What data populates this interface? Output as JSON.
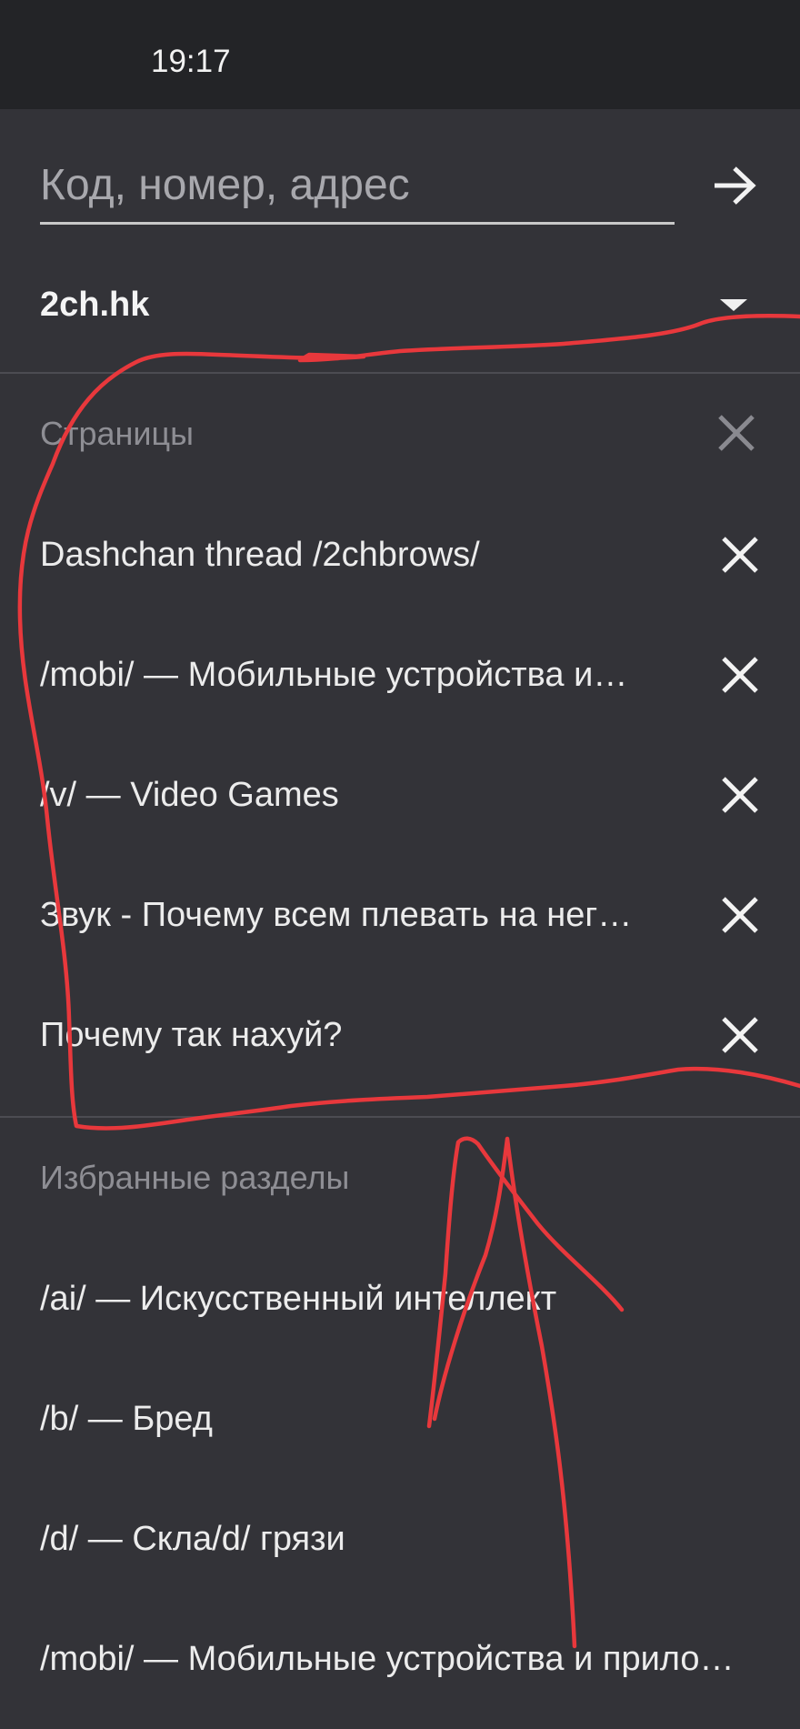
{
  "status_bar": {
    "time": "19:17"
  },
  "search": {
    "placeholder": "Код, номер, адрес",
    "value": ""
  },
  "board_selector": {
    "host": "2ch.hk"
  },
  "pages": {
    "header": "Страницы",
    "items": [
      {
        "label": "Dashchan thread /2chbrows/"
      },
      {
        "label": "/mobi/ — Мобильные устройства и…"
      },
      {
        "label": "/v/ — Video Games"
      },
      {
        "label": "Звук - Почему всем плевать на нег…"
      },
      {
        "label": "Почему так нахуй?"
      }
    ]
  },
  "favorites": {
    "header": "Избранные разделы",
    "items": [
      {
        "label": "/ai/ — Искусственный интеллект"
      },
      {
        "label": "/b/ — Бред"
      },
      {
        "label": "/d/ — Скла/d/ грязи"
      },
      {
        "label": "/mobi/ — Мобильные устройства и прило…"
      }
    ]
  },
  "colors": {
    "background": "#333338",
    "statusbar": "#232427",
    "annotation": "#e8383c"
  }
}
